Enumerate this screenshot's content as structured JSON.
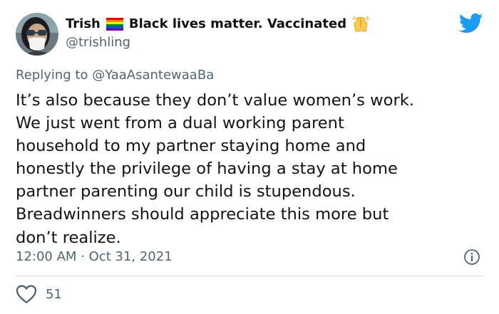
{
  "author": {
    "display_name": "Trish",
    "bio_suffix": "Black lives matter. Vaccinated",
    "handle": "@trishling",
    "flag_icon": "rainbow-flag-icon",
    "hands_icon": "raised-hands-icon"
  },
  "reply": {
    "prefix": "Replying to",
    "mention": "@YaaAsantewaaBa"
  },
  "tweet": {
    "text": "It’s also because they don’t value women’s work.\nWe just went from a dual working parent\nhousehold to my partner staying home and\nhonestly the privilege of having a stay at home\npartner parenting our child is stupendous.\nBreadwinners should appreciate this more but\ndon’t realize."
  },
  "meta": {
    "time": "12:00 AM",
    "separator": "·",
    "date": "Oct 31, 2021"
  },
  "engagement": {
    "likes": "51"
  },
  "colors": {
    "text": "#0f1419",
    "secondary": "#536471",
    "twitter_blue": "#1d9bf0",
    "divider": "#cfd9de"
  }
}
